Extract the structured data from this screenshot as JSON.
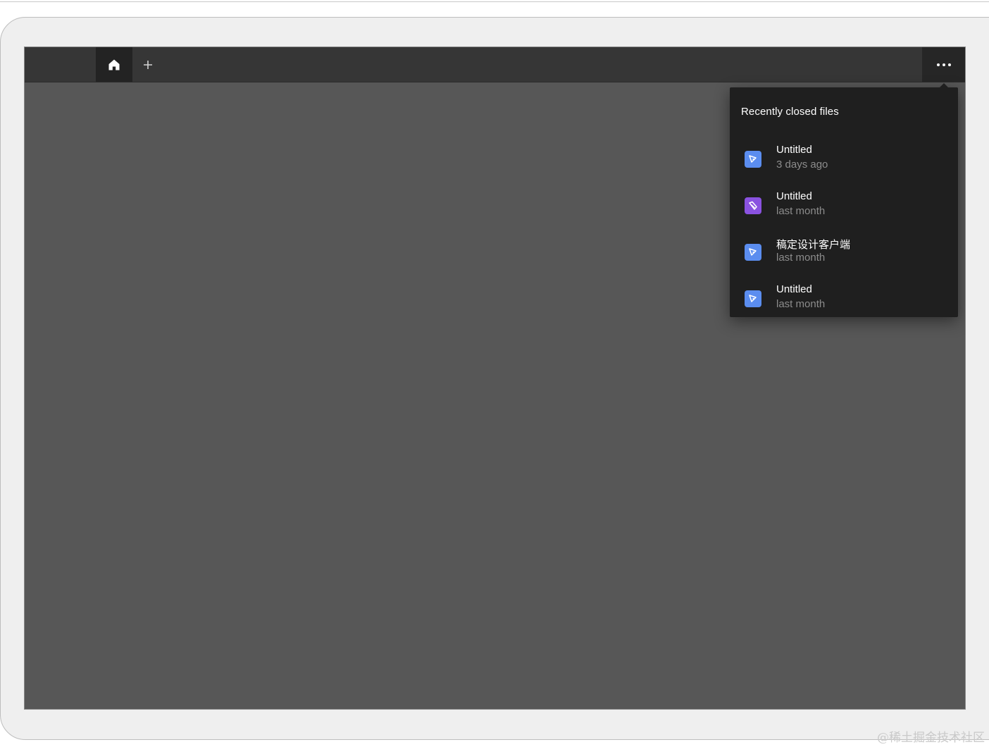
{
  "tabbar": {
    "home_icon": "home-icon",
    "new_tab_label": "+",
    "more_icon": "more-horizontal-icon"
  },
  "recent_menu": {
    "title": "Recently closed files",
    "items": [
      {
        "name": "Untitled",
        "time": "3 days ago",
        "icon": "design-file-icon",
        "color": "#5b8def"
      },
      {
        "name": "Untitled",
        "time": "last month",
        "icon": "prototype-file-icon",
        "color": "#8a52e0"
      },
      {
        "name": "稿定设计客户端",
        "time": "last month",
        "icon": "design-file-icon",
        "color": "#5b8def"
      },
      {
        "name": "Untitled",
        "time": "last month",
        "icon": "design-file-icon",
        "color": "#5b8def"
      }
    ]
  },
  "colors": {
    "tabbar_bg": "#363636",
    "canvas_bg": "#575757",
    "menu_bg": "#1f1f1f",
    "design_file": "#5b8def",
    "prototype_file": "#8a52e0"
  },
  "watermark": "@稀土掘金技术社区"
}
